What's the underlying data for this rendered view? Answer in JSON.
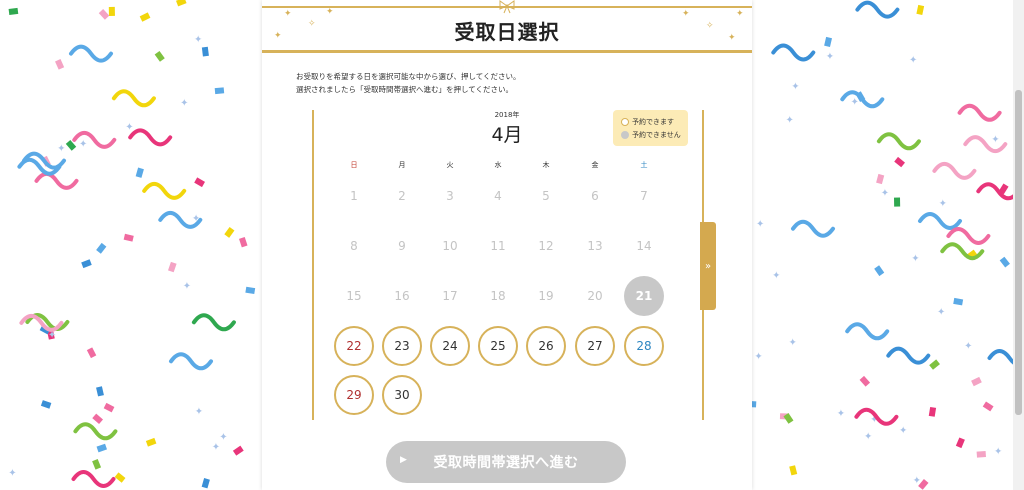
{
  "header": {
    "title": "受取日選択"
  },
  "instructions": {
    "line1": "お受取りを希望する日を選択可能な中から選び、押してください。",
    "line2": "選択されましたら「受取時間帯選択へ進む」を押してください。"
  },
  "calendar": {
    "year_label": "2018年",
    "month_label": "4月",
    "weekdays": [
      "日",
      "月",
      "火",
      "水",
      "木",
      "金",
      "土"
    ],
    "weeks": [
      [
        {
          "d": "1",
          "s": "past"
        },
        {
          "d": "2",
          "s": "past"
        },
        {
          "d": "3",
          "s": "past"
        },
        {
          "d": "4",
          "s": "past"
        },
        {
          "d": "5",
          "s": "past"
        },
        {
          "d": "6",
          "s": "past"
        },
        {
          "d": "7",
          "s": "past"
        }
      ],
      [
        {
          "d": "8",
          "s": "past"
        },
        {
          "d": "9",
          "s": "past"
        },
        {
          "d": "10",
          "s": "past"
        },
        {
          "d": "11",
          "s": "past"
        },
        {
          "d": "12",
          "s": "past"
        },
        {
          "d": "13",
          "s": "past"
        },
        {
          "d": "14",
          "s": "past"
        }
      ],
      [
        {
          "d": "15",
          "s": "past"
        },
        {
          "d": "16",
          "s": "past"
        },
        {
          "d": "17",
          "s": "past"
        },
        {
          "d": "18",
          "s": "past"
        },
        {
          "d": "19",
          "s": "past"
        },
        {
          "d": "20",
          "s": "past"
        },
        {
          "d": "21",
          "s": "unavailable"
        }
      ],
      [
        {
          "d": "22",
          "s": "available"
        },
        {
          "d": "23",
          "s": "available"
        },
        {
          "d": "24",
          "s": "available"
        },
        {
          "d": "25",
          "s": "available"
        },
        {
          "d": "26",
          "s": "available"
        },
        {
          "d": "27",
          "s": "available"
        },
        {
          "d": "28",
          "s": "available"
        }
      ],
      [
        {
          "d": "29",
          "s": "available"
        },
        {
          "d": "30",
          "s": "available"
        }
      ]
    ]
  },
  "legend": {
    "available": "予約できます",
    "unavailable": "予約できません"
  },
  "next_month_icon": "double-chevron-right-icon",
  "next_month_glyph": "»",
  "proceed_button": {
    "label": "受取時間帯選択へ進む",
    "arrow": "▶"
  },
  "colors": {
    "gold": "#d7b25a",
    "tab_gold": "#d4a94f",
    "legend_bg": "#fcebb6",
    "disabled_gray": "#c8c8c8",
    "sunday_red": "#b03030",
    "saturday_blue": "#2e86c1"
  }
}
